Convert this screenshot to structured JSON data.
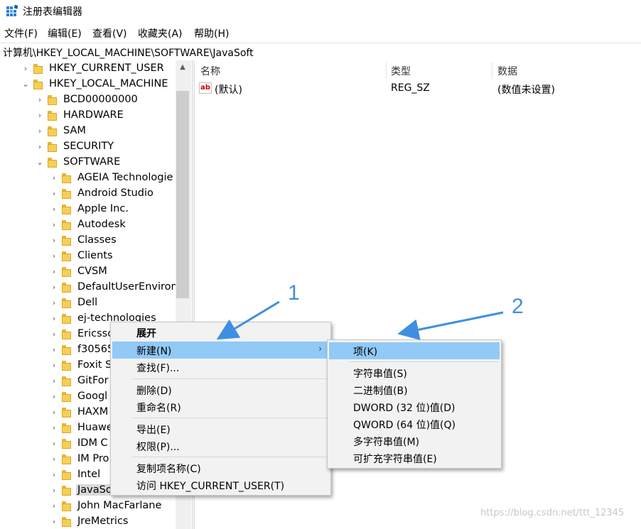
{
  "window": {
    "title": "注册表编辑器",
    "icon": "registry-editor-icon"
  },
  "menubar": [
    "文件(F)",
    "编辑(E)",
    "查看(V)",
    "收藏夹(A)",
    "帮助(H)"
  ],
  "address": "计算机\\HKEY_LOCAL_MACHINE\\SOFTWARE\\JavaSoft",
  "tree": {
    "items": [
      {
        "label": "HKEY_CURRENT_USER",
        "expanded": false
      },
      {
        "label": "HKEY_LOCAL_MACHINE",
        "expanded": true
      },
      {
        "label": "BCD00000000",
        "expanded": false
      },
      {
        "label": "HARDWARE",
        "expanded": false
      },
      {
        "label": "SAM",
        "expanded": false
      },
      {
        "label": "SECURITY",
        "expanded": false
      },
      {
        "label": "SOFTWARE",
        "expanded": true
      },
      {
        "label": "AGEIA Technologie",
        "expanded": false
      },
      {
        "label": "Android Studio",
        "expanded": false
      },
      {
        "label": "Apple Inc.",
        "expanded": false
      },
      {
        "label": "Autodesk",
        "expanded": false
      },
      {
        "label": "Classes",
        "expanded": false
      },
      {
        "label": "Clients",
        "expanded": false
      },
      {
        "label": "CVSM",
        "expanded": false
      },
      {
        "label": "DefaultUserEnviron",
        "expanded": false
      },
      {
        "label": "Dell",
        "expanded": false
      },
      {
        "label": "ej-technologies",
        "expanded": false
      },
      {
        "label": "Ericsso",
        "expanded": false
      },
      {
        "label": "f30565",
        "expanded": false
      },
      {
        "label": "Foxit S",
        "expanded": false
      },
      {
        "label": "GitFor",
        "expanded": false
      },
      {
        "label": "Googl",
        "expanded": false
      },
      {
        "label": "HAXM",
        "expanded": false
      },
      {
        "label": "Huawe",
        "expanded": false
      },
      {
        "label": "IDM C",
        "expanded": false
      },
      {
        "label": "IM Pro",
        "expanded": false
      },
      {
        "label": "Intel",
        "expanded": false
      },
      {
        "label": "JavaSo",
        "expanded": false,
        "selected": true
      },
      {
        "label": "John MacFarlane",
        "expanded": false
      },
      {
        "label": "JreMetrics",
        "expanded": false
      }
    ]
  },
  "list": {
    "columns": [
      "名称",
      "类型",
      "数据"
    ],
    "rows": [
      {
        "icon": "string-value-icon",
        "icon_text": "ab",
        "name": "(默认)",
        "type": "REG_SZ",
        "data": "(数值未设置)"
      }
    ]
  },
  "context_menu": {
    "items": [
      "展开",
      "新建(N)",
      "查找(F)...",
      "删除(D)",
      "重命名(R)",
      "导出(E)",
      "权限(P)...",
      "复制项名称(C)",
      "访问 HKEY_CURRENT_USER(T)"
    ],
    "highlighted": "新建(N)"
  },
  "submenu": {
    "items": [
      "项(K)",
      "字符串值(S)",
      "二进制值(B)",
      "DWORD (32 位)值(D)",
      "QWORD (64 位)值(Q)",
      "多字符串值(M)",
      "可扩充字符串值(E)"
    ],
    "highlighted": "项(K)"
  },
  "annotations": {
    "label_1": "1",
    "label_2": "2",
    "arrow_color": "#3f8fe0"
  },
  "watermark": "https://blog.csdn.net/ttt_12345",
  "colors": {
    "highlight": "#91c9f7",
    "folder": "#f6cf56",
    "menu_bg": "#f2f2f2"
  }
}
